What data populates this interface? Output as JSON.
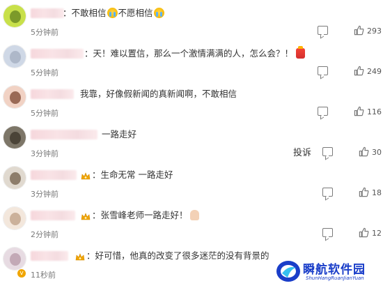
{
  "comments": [
    {
      "text_prefix": "：不敢相信",
      "text_mid": "不愿相信",
      "time": "5分钟前",
      "likes": "293",
      "avatar_colors": [
        "#c8e04a",
        "#7c9a2a"
      ],
      "text_left": 90
    },
    {
      "text": "：天！难以置信，那么一个激情满满的人，怎么会？！",
      "time": "5分钟前",
      "likes": "249",
      "avatar_colors": [
        "#cfd8e6",
        "#aeb8c9"
      ],
      "text_left": 121
    },
    {
      "text": "我靠，好像假新闻的真新闻啊，不敢相信",
      "time": "5分钟前",
      "likes": "116",
      "avatar_colors": [
        "#f1d2c4",
        "#9a6a56"
      ],
      "text_left": 115
    },
    {
      "text": "一路走好",
      "time": "3分钟前",
      "likes": "30",
      "report": "投诉",
      "avatar_colors": [
        "#7d7668",
        "#4b4438"
      ],
      "text_left": 146
    },
    {
      "text": "：生命无常 一路走好",
      "time": "3分钟前",
      "likes": "18",
      "avatar_colors": [
        "#e0d9cf",
        "#8d7d6b"
      ],
      "text_left": 132
    },
    {
      "text": "：张雪峰老师一路走好！",
      "time": "2分钟前",
      "likes": "12",
      "avatar_colors": [
        "#f3e7dc",
        "#cbb19b"
      ],
      "text_left": 132
    },
    {
      "text": "：好可惜，他真的改变了很多迷茫的没有背景的",
      "time": "11秒前",
      "likes": "",
      "avatar_colors": [
        "#e7dbe2",
        "#c3a9b6"
      ],
      "text_left": 124
    }
  ],
  "watermark": {
    "title": "瞬航软件园",
    "subtitle": "ShunHangRuanJianYuan"
  },
  "icons": {
    "reply": "comment-icon",
    "like": "thumbs-up-icon",
    "crown": "vip-crown-icon",
    "emoji_cry": "crying-face-emoji",
    "emoji_gift": "red-packet-emoji",
    "emoji_pray": "praying-hands-emoji",
    "badge": "verified-badge-icon"
  },
  "colors": {
    "accent": "#1a3ec9",
    "crown": "#f0a500",
    "text": "#333333",
    "meta": "#7a7a7a"
  }
}
